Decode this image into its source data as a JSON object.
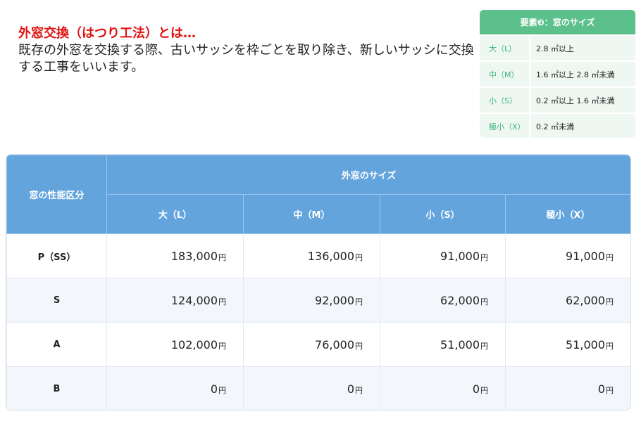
{
  "intro": {
    "title": "外窓交換（はつり工法）とは…",
    "body": "既存の外窓を交換する際、古いサッシを枠ごとを取り除き、新しいサッシに交換する工事をいいます。"
  },
  "legend": {
    "title": "要素❸：窓のサイズ",
    "rows": [
      {
        "key": "大（L）",
        "value": "2.8 ㎡以上"
      },
      {
        "key": "中（M）",
        "value": "1.6 ㎡以上 2.8 ㎡未満"
      },
      {
        "key": "小（S）",
        "value": "0.2 ㎡以上 1.6 ㎡未満"
      },
      {
        "key": "極小（X）",
        "value": "0.2 ㎡未満"
      }
    ]
  },
  "table": {
    "row_header_title": "窓の性能区分",
    "group_header": "外窓のサイズ",
    "columns": [
      "大（L）",
      "中（M）",
      "小（S）",
      "極小（X）"
    ],
    "currency": "円",
    "rows": [
      {
        "label": "P（SS）",
        "values": [
          "183,000",
          "136,000",
          "91,000",
          "91,000"
        ]
      },
      {
        "label": "S",
        "values": [
          "124,000",
          "92,000",
          "62,000",
          "62,000"
        ]
      },
      {
        "label": "A",
        "values": [
          "102,000",
          "76,000",
          "51,000",
          "51,000"
        ]
      },
      {
        "label": "B",
        "values": [
          "0",
          "0",
          "0",
          "0"
        ]
      }
    ]
  },
  "colors": {
    "title_red": "#e0120f",
    "legend_green": "#5cc08c",
    "table_blue": "#63a4dd"
  }
}
